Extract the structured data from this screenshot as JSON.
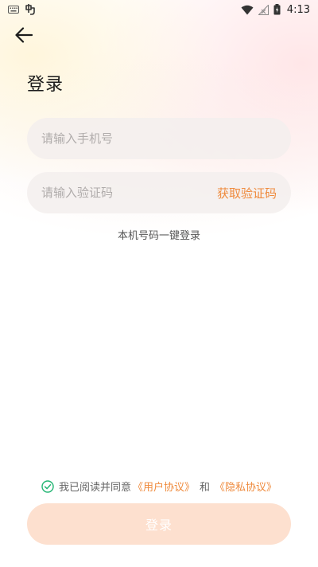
{
  "status_bar": {
    "time": "4:13",
    "icons": [
      "keyboard-icon",
      "app-notification-icon",
      "wifi-icon",
      "signal-icon",
      "battery-icon"
    ]
  },
  "header": {
    "back_icon": "arrow-left-icon",
    "title": "登录"
  },
  "form": {
    "phone_placeholder": "请输入手机号",
    "phone_value": "",
    "code_placeholder": "请输入验证码",
    "code_value": "",
    "get_code_label": "获取验证码",
    "one_click_login": "本机号码一键登录"
  },
  "agreement": {
    "checked": true,
    "prefix": "我已阅读并同意",
    "user_agreement": "《用户协议》",
    "and": "和",
    "privacy_policy": "《隐私协议》"
  },
  "submit": {
    "label": "登录"
  },
  "colors": {
    "accent": "#ef8a3c",
    "button_bg": "#fde0cf",
    "field_bg": "#f3eeed",
    "check": "#22b573"
  }
}
